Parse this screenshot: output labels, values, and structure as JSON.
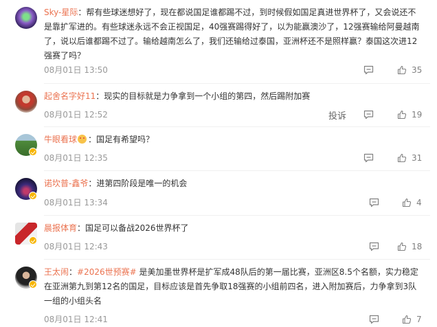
{
  "comments": [
    {
      "username": "Sky-星际",
      "text": "：帮有些球迷想好了，现在都说国足谁都踢不过，到时候假如国足真进世界杯了，又会说还不是靠扩军进的。有些球迷永远不会正视国足，40强赛踢得好了，以为能赢澳沙了，12强赛输给阿曼越南了，说以后谁都踢不过了。输给越南怎么了，我们还输给过泰国，亚洲杯还不是照样赢？泰国这次进12强赛了吗？",
      "time": "08月01日 13:50",
      "likes": "35",
      "verified": false,
      "avatar": "galaxy"
    },
    {
      "username": "起舍名字好11",
      "text": "：现实的目标就是力争拿到一个小组的第四，然后踢附加赛",
      "time": "08月01日 12:52",
      "likes": "19",
      "report_label": "投诉",
      "verified": false,
      "avatar": "person"
    },
    {
      "username": "牛眼看球",
      "text": "：国足有希望吗？",
      "time": "08月01日 12:35",
      "likes": "31",
      "verified": true,
      "avatar": "field"
    },
    {
      "username": "诺坎普-鑫爷",
      "text": "：进第四阶段是唯一的机会",
      "time": "08月01日 13:34",
      "likes": "4",
      "verified": true,
      "avatar": "stadium"
    },
    {
      "username": "晨报体育",
      "text": "：国足可以备战2026世界杯了",
      "time": "08月01日 12:43",
      "likes": "18",
      "verified": true,
      "avatar": "logo"
    },
    {
      "username": "王太闹",
      "hashtag": "#2026世预赛#",
      "text": " 是美加墨世界杯是扩军成48队后的第一届比赛，亚洲区8.5个名额，实力稳定在亚洲第九到第12名的国足，目标应该是首先争取18强赛的小组前四名，进入附加赛后，力争拿到3队一组的小组头名",
      "time": "08月01日 12:41",
      "likes": "7",
      "verified": true,
      "avatar": "dark"
    }
  ],
  "colors": {
    "username": "#eb7350",
    "badge": "#f7b500",
    "meta": "#999999"
  },
  "icons": {
    "comment": "comment-icon",
    "like": "thumb-up-icon",
    "verified": "verified-badge-icon"
  }
}
